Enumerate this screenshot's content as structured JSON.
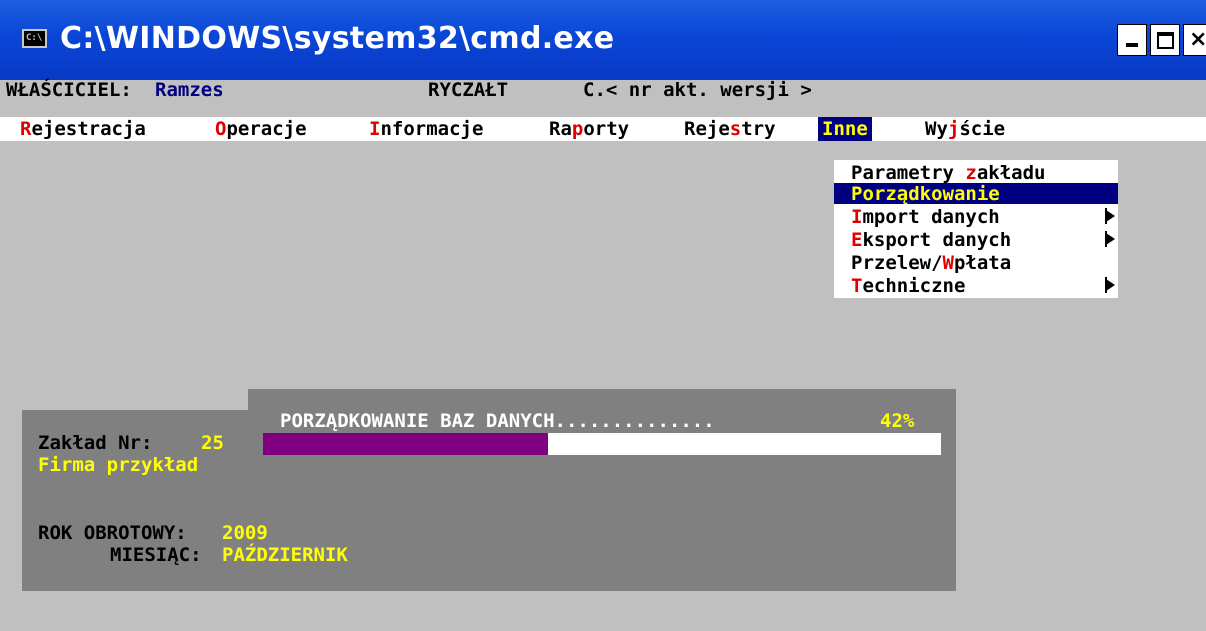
{
  "window": {
    "title": "C:\\WINDOWS\\system32\\cmd.exe",
    "icon": "console-icon",
    "icon_text": "C:\\",
    "minimize_glyph": "minimize-icon",
    "maximize_glyph": "maximize-icon",
    "close_glyph": "×"
  },
  "header": {
    "owner_label": "WŁAŚCICIEL:",
    "owner_value": "Ramzes",
    "mode": "RYCZAŁT",
    "version": "C.< nr akt. wersji >"
  },
  "menu": {
    "items": [
      {
        "pre": "",
        "hot": "R",
        "post": "ejestracja"
      },
      {
        "pre": "",
        "hot": "O",
        "post": "peracje"
      },
      {
        "pre": "",
        "hot": "I",
        "post": "nformacje"
      },
      {
        "pre": "Ra",
        "hot": "p",
        "post": "orty"
      },
      {
        "pre": "Reje",
        "hot": "s",
        "post": "try"
      },
      {
        "pre": "",
        "hot": "",
        "post": "Inne"
      },
      {
        "pre": "Wy",
        "hot": "j",
        "post": "ście"
      }
    ],
    "active": "Inne"
  },
  "dropdown": {
    "items": [
      {
        "pre": "Parametry ",
        "hot": "z",
        "post": "akładu",
        "submenu": false,
        "selected": false
      },
      {
        "pre": "Porządkowanie",
        "hot": "",
        "post": "",
        "submenu": false,
        "selected": true
      },
      {
        "pre": "",
        "hot": "I",
        "post": "mport danych",
        "submenu": true,
        "selected": false
      },
      {
        "pre": "",
        "hot": "E",
        "post": "ksport danych",
        "submenu": true,
        "selected": false
      },
      {
        "pre": "Przelew/",
        "hot": "W",
        "post": "płata",
        "submenu": false,
        "selected": false
      },
      {
        "pre": "",
        "hot": "T",
        "post": "echniczne",
        "submenu": true,
        "selected": false
      }
    ]
  },
  "progress": {
    "title": "PORZĄDKOWANIE BAZ DANYCH..............",
    "percent_label": "42%",
    "fraction": 0.42
  },
  "info": {
    "plant_label": "Zakład Nr:",
    "plant_number": "25",
    "company": "Firma przykład",
    "year_label": "ROK OBROTOWY:",
    "year": "2009",
    "month_label": "MIESIĄC:",
    "month": "PAŹDZIERNIK"
  },
  "colors": {
    "console_bg": "#c0c0c0",
    "menu_bg": "#ffffff",
    "highlight": "#000080",
    "hotkey": "#e00000",
    "dialog_bg": "#808080",
    "progress_fill": "#800080",
    "accent_text": "#ffff00"
  }
}
